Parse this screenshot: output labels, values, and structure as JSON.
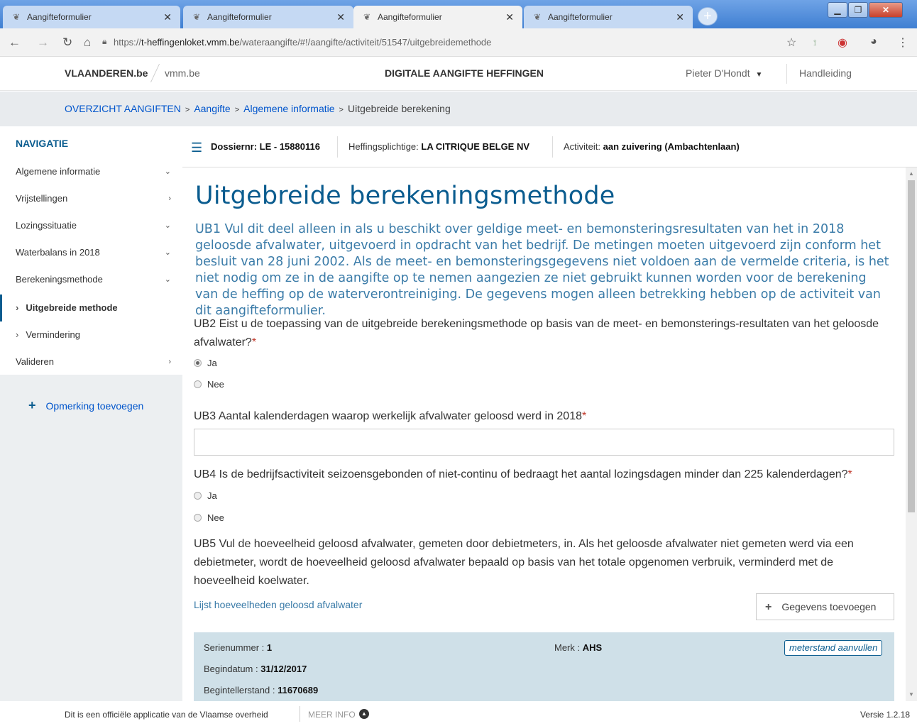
{
  "browser": {
    "tabs": [
      {
        "label": "Aangifteformulier"
      },
      {
        "label": "Aangifteformulier"
      },
      {
        "label": "Aangifteformulier"
      },
      {
        "label": "Aangifteformulier"
      }
    ],
    "url_prefix": "https://",
    "url_host": "t-heffingenloket.vmm.be",
    "url_path": "/wateraangifte/#!/aangifte/activiteit/51547/uitgebreidemethode"
  },
  "header": {
    "brand": "VLAANDEREN.be",
    "sub_brand": "vmm.be",
    "title": "DIGITALE AANGIFTE HEFFINGEN",
    "user": "Pieter D'Hondt",
    "manual": "Handleiding"
  },
  "breadcrumb": {
    "items": [
      "OVERZICHT AANGIFTEN",
      "Aangifte",
      "Algemene informatie",
      "Uitgebreide berekening"
    ]
  },
  "sidebar": {
    "title": "NAVIGATIE",
    "items": [
      {
        "label": "Algemene informatie"
      },
      {
        "label": "Vrijstellingen"
      },
      {
        "label": "Lozingssituatie"
      },
      {
        "label": "Waterbalans in 2018"
      },
      {
        "label": "Berekeningsmethode"
      },
      {
        "label": "Uitgebreide methode"
      },
      {
        "label": "Vermindering"
      },
      {
        "label": "Valideren"
      }
    ],
    "add_note": "Opmerking toevoegen"
  },
  "infobar": {
    "dossier_label": "Dossiernr:",
    "dossier_value": "LE - 15880116",
    "plichtige_label": "Heffingsplichtige:",
    "plichtige_value": "LA CITRIQUE BELGE NV",
    "activiteit_label": "Activiteit:",
    "activiteit_value": "aan zuivering (Ambachtenlaan)"
  },
  "main": {
    "title": "Uitgebreide berekeningsmethode",
    "intro": "UB1 Vul dit deel alleen in als u beschikt over geldige meet- en bemonsteringsresultaten van het in 2018 geloosde afvalwater, uitgevoerd in opdracht van het bedrijf. De metingen moeten uitgevoerd zijn conform het besluit van 28 juni 2002. Als de meet- en bemonsteringsgegevens niet voldoen aan de vermelde criteria, is het niet nodig om ze in de aangifte op te nemen aangezien ze niet gebruikt kunnen worden voor de berekening van de heffing op de waterverontreiniging. De gegevens mogen alleen betrekking hebben op de activiteit van dit aangifteformulier.",
    "ub2": "UB2 Eist u de toepassing van de uitgebreide berekeningsmethode op basis van de meet- en bemonsterings-resultaten van het geloosde afvalwater?",
    "ub2_options": [
      "Ja",
      "Nee"
    ],
    "ub3": "UB3 Aantal kalenderdagen waarop werkelijk afvalwater geloosd werd in 2018",
    "ub3_value": "",
    "ub4": "UB4 Is de bedrijfsactiviteit seizoensgebonden of niet-continu of bedraagt het aantal lozingsdagen minder dan 225 kalenderdagen?",
    "ub4_options": [
      "Ja",
      "Nee"
    ],
    "ub5": "UB5 Vul de hoeveelheid geloosd afvalwater, gemeten door debietmeters, in. Als het geloosde afvalwater niet gemeten werd via een debietmeter, wordt de hoeveelheid geloosd afvalwater bepaald op basis van het totale opgenomen verbruik, verminderd met de hoeveelheid koelwater.",
    "list_link": "Lijst hoeveelheden geloosd afvalwater",
    "add_button": "Gegevens toevoegen",
    "required_mark": "*"
  },
  "meter": {
    "serial_label": "Serienummer :",
    "serial_value": "1",
    "brand_label": "Merk :",
    "brand_value": "AHS",
    "start_date_label": "Begindatum :",
    "start_date_value": "31/12/2017",
    "start_reading_label": "Begintellerstand :",
    "start_reading_value": "11670689",
    "complete_button": "meterstand aanvullen"
  },
  "footer": {
    "text": "Dit is een officiële applicatie van de Vlaamse overheid",
    "more": "MEER INFO",
    "version": "Versie 1.2.18"
  }
}
